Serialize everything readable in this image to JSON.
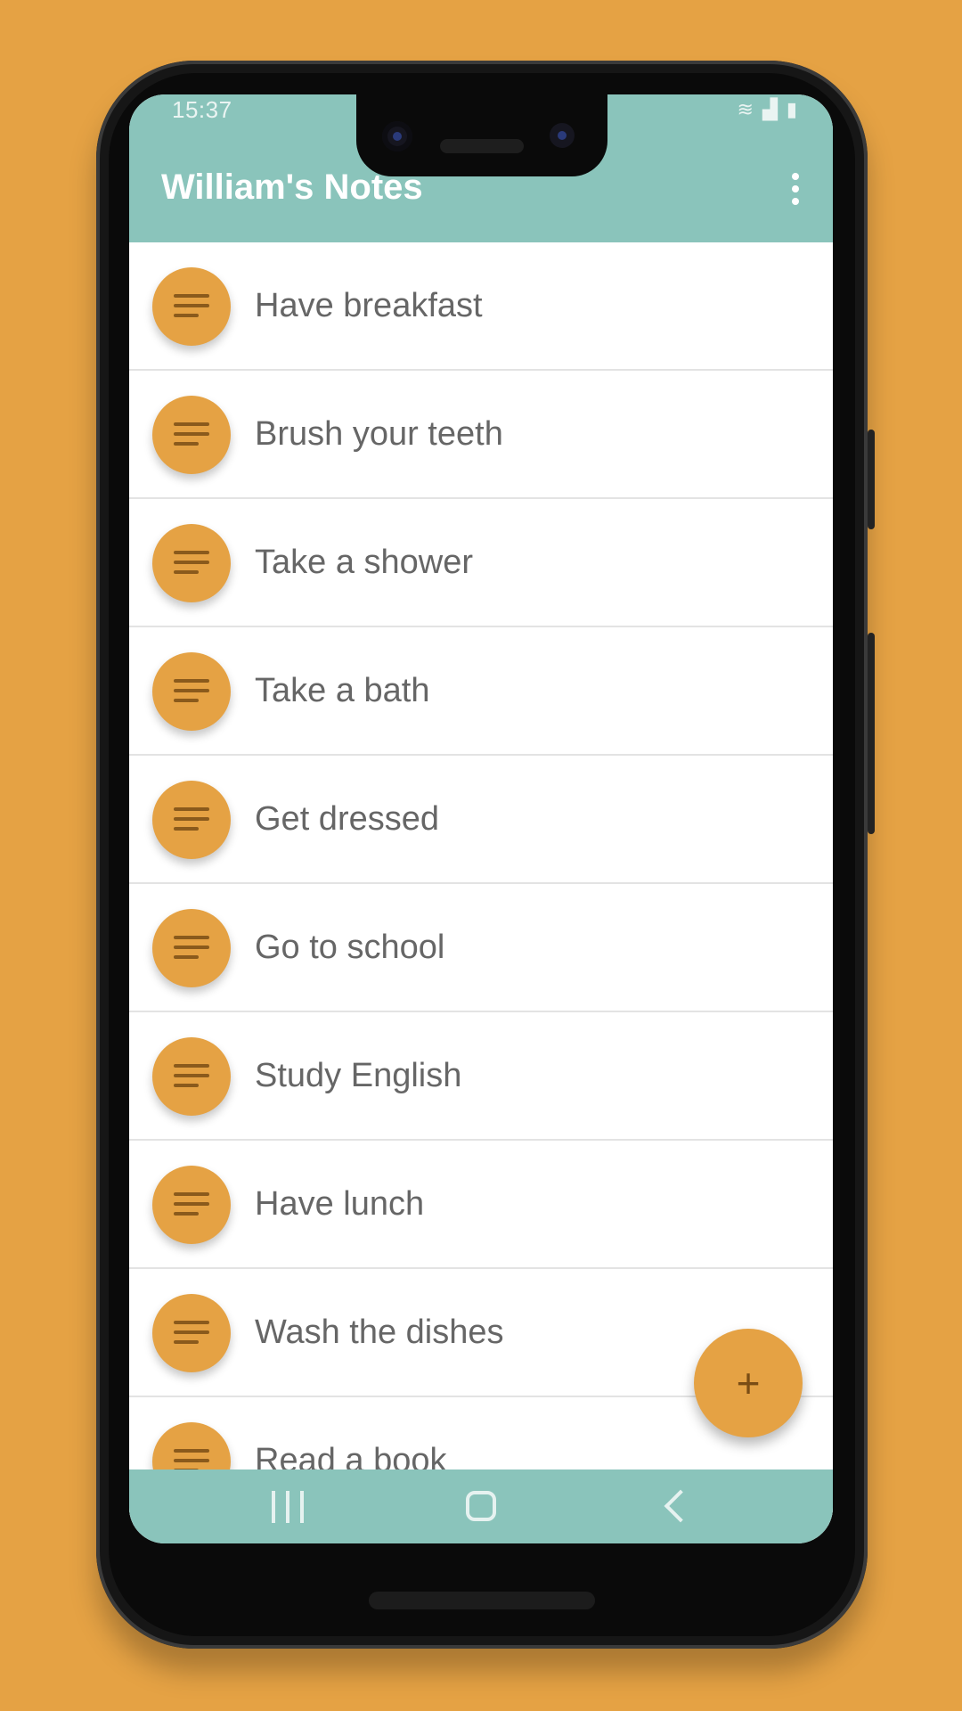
{
  "status_bar": {
    "time": "15:37"
  },
  "app_bar": {
    "title": "William's Notes"
  },
  "notes": [
    {
      "label": "Have breakfast"
    },
    {
      "label": "Brush your teeth"
    },
    {
      "label": "Take a shower"
    },
    {
      "label": "Take a bath"
    },
    {
      "label": "Get dressed"
    },
    {
      "label": "Go to school"
    },
    {
      "label": "Study English"
    },
    {
      "label": "Have lunch"
    },
    {
      "label": "Wash the dishes"
    },
    {
      "label": "Read a book"
    }
  ],
  "fab": {
    "symbol": "+"
  },
  "colors": {
    "accent": "#E5A244",
    "app_bar": "#8AC4BB",
    "text": "#666666"
  },
  "icons": {
    "note": "notes-icon",
    "menu": "more-vert-icon",
    "add": "add-icon",
    "nav": [
      "recents-icon",
      "home-icon",
      "back-icon"
    ]
  }
}
